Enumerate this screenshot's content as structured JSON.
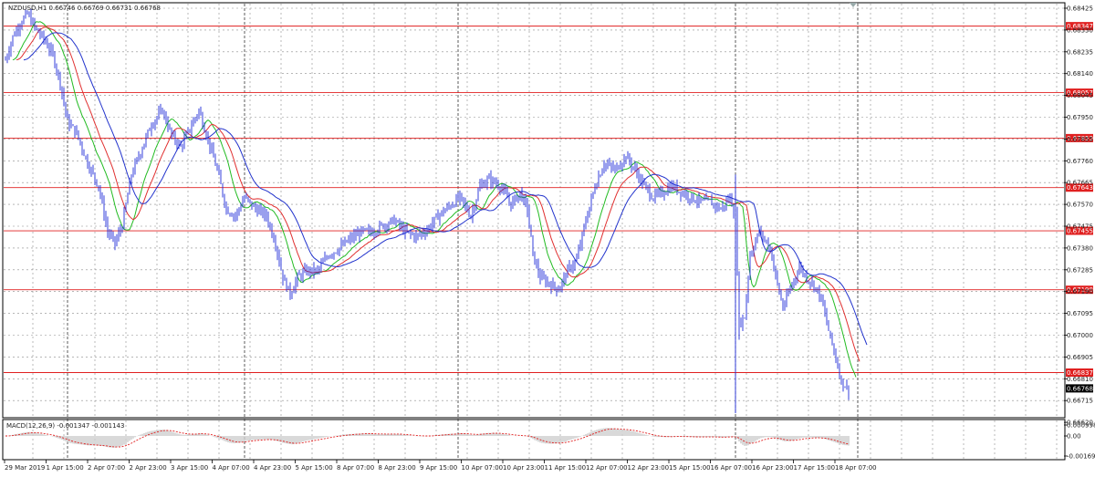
{
  "main_chart": {
    "title": "NZDUSD,H1  0.66746 0.66769 0.66731 0.66768",
    "price_ticks": [
      "0.68425",
      "0.68330",
      "0.68235",
      "0.68140",
      "0.68045",
      "0.67950",
      "0.67855",
      "0.67760",
      "0.67665",
      "0.67570",
      "0.67475",
      "0.67380",
      "0.67285",
      "0.67190",
      "0.67095",
      "0.67000",
      "0.66905",
      "0.66810",
      "0.66715",
      "0.66620"
    ],
    "levels": [
      {
        "label": "0.68347",
        "value": 0.68347
      },
      {
        "label": "0.68057",
        "value": 0.68057
      },
      {
        "label": "0.67859",
        "value": 0.67859
      },
      {
        "label": "0.67643",
        "value": 0.67643
      },
      {
        "label": "0.67455",
        "value": 0.67455
      },
      {
        "label": "0.67198",
        "value": 0.67198
      },
      {
        "label": "0.66837",
        "value": 0.66837
      }
    ],
    "current_price": {
      "label": "0.66768",
      "value": 0.66768
    },
    "colors": {
      "candles": "#1f2bd8",
      "level_line": "#e02020",
      "level_label": "#e02020",
      "ma_fast": "#22bb22",
      "ma_mid": "#e03030",
      "ma_slow": "#2233cc",
      "grid": "#8c8c8c",
      "current_bg": "#000000"
    }
  },
  "macd": {
    "title": "MACD(12,26,9) -0.001347 -0.001143",
    "ticks": [
      "0.000998",
      "0.00",
      "-0.00169"
    ],
    "colors": {
      "histogram": "#a0a0a0",
      "signal": "#e02020"
    }
  },
  "time_axis": {
    "labels": [
      "29 Mar 2019",
      "1 Apr 15:00",
      "2 Apr 07:00",
      "2 Apr 23:00",
      "3 Apr 15:00",
      "4 Apr 07:00",
      "4 Apr 23:00",
      "5 Apr 15:00",
      "8 Apr 07:00",
      "8 Apr 23:00",
      "9 Apr 15:00",
      "10 Apr 07:00",
      "10 Apr 23:00",
      "11 Apr 15:00",
      "12 Apr 07:00",
      "12 Apr 23:00",
      "15 Apr 15:00",
      "16 Apr 07:00",
      "16 Apr 23:00",
      "17 Apr 15:00",
      "18 Apr 07:00"
    ]
  }
}
